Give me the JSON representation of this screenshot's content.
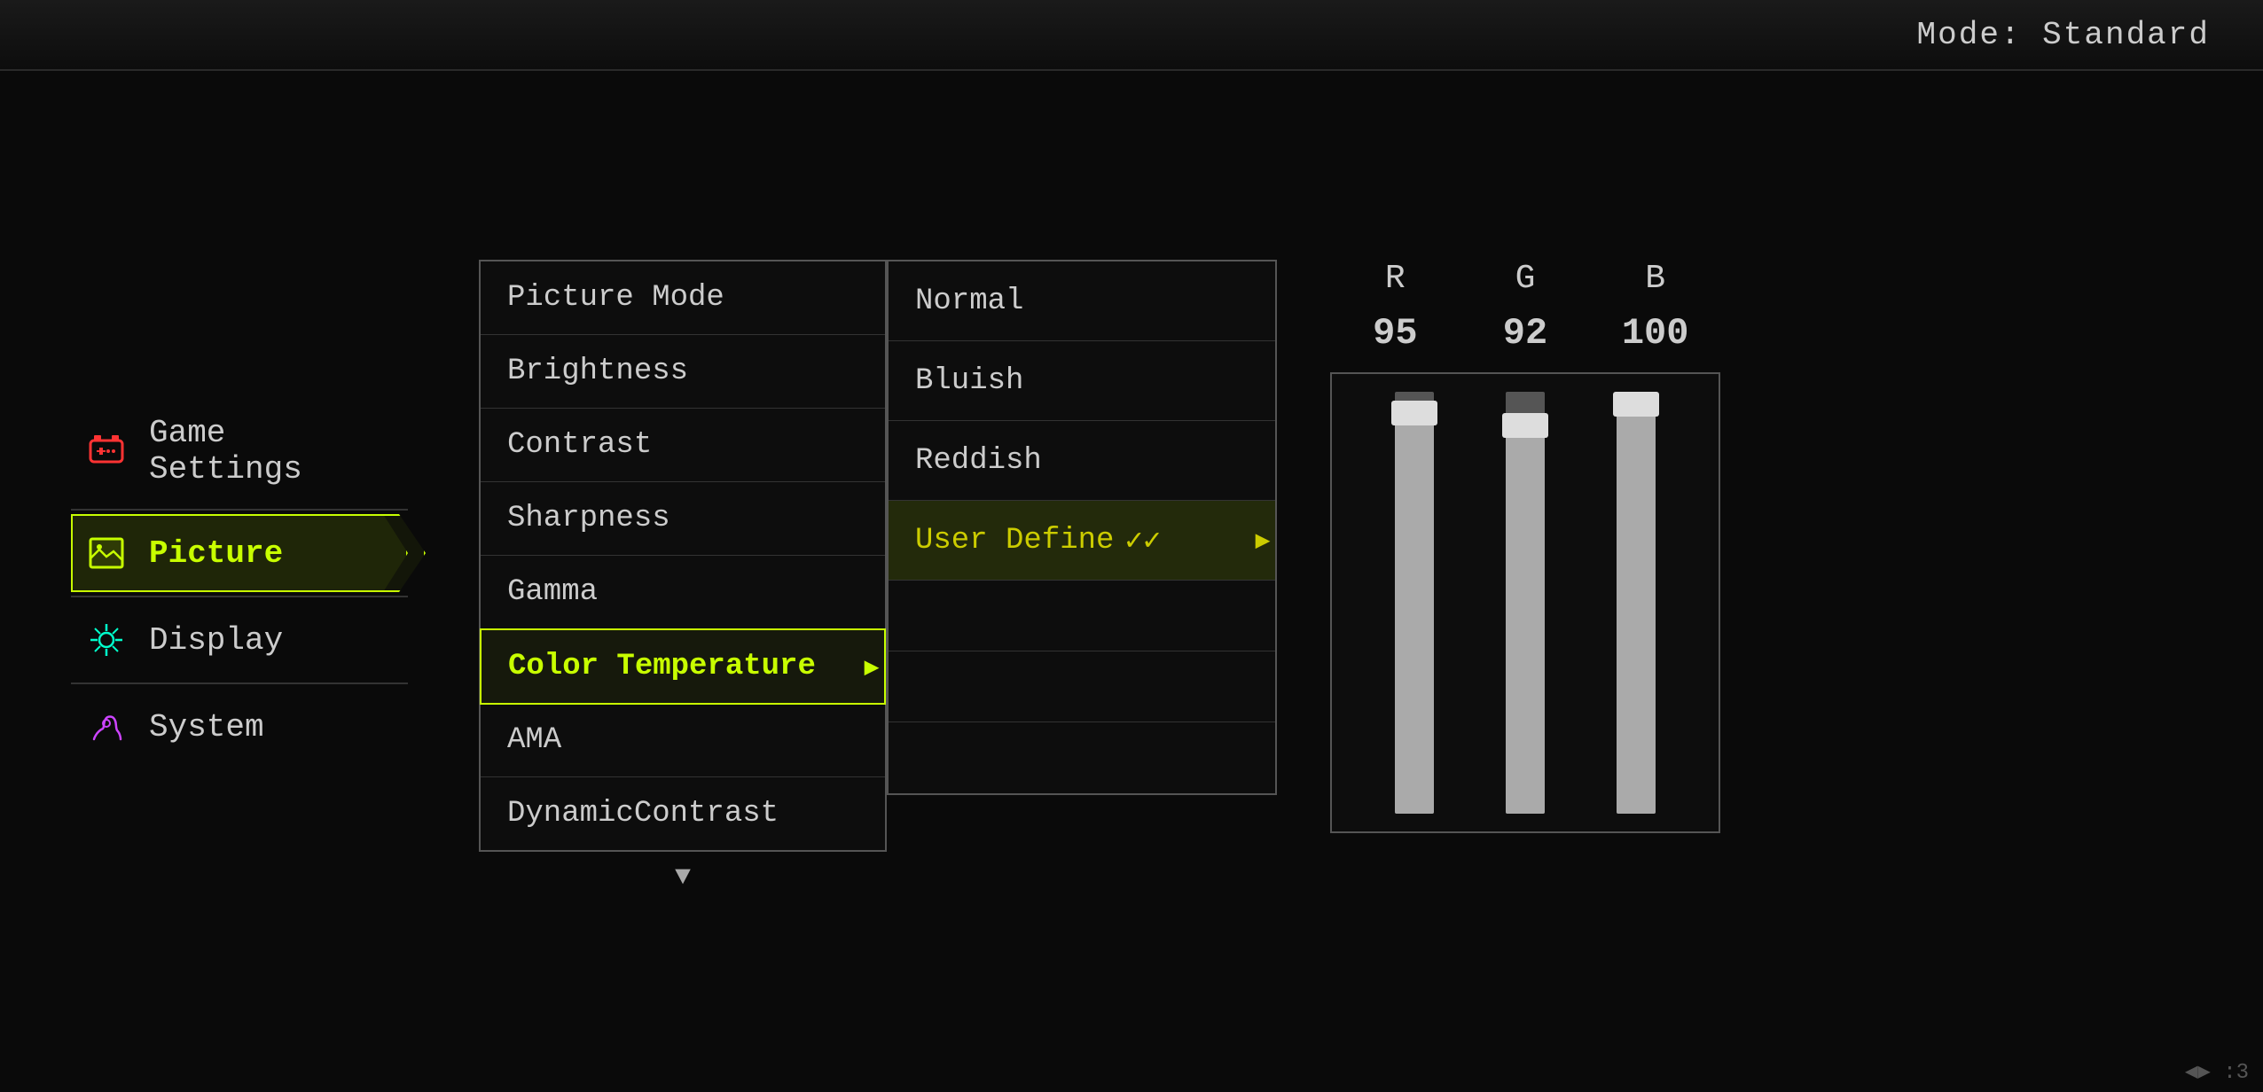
{
  "topbar": {
    "mode_label": "Mode: Standard"
  },
  "nav": {
    "items": [
      {
        "id": "game-settings",
        "label": "Game Settings",
        "icon": "game",
        "active": false
      },
      {
        "id": "picture",
        "label": "Picture",
        "icon": "picture",
        "active": true
      },
      {
        "id": "display",
        "label": "Display",
        "icon": "display",
        "active": false
      },
      {
        "id": "system",
        "label": "System",
        "icon": "system",
        "active": false
      }
    ]
  },
  "picture_menu": {
    "items": [
      {
        "id": "picture-mode",
        "label": "Picture Mode",
        "active": false
      },
      {
        "id": "brightness",
        "label": "Brightness",
        "active": false
      },
      {
        "id": "contrast",
        "label": "Contrast",
        "active": false
      },
      {
        "id": "sharpness",
        "label": "Sharpness",
        "active": false
      },
      {
        "id": "gamma",
        "label": "Gamma",
        "active": false
      },
      {
        "id": "color-temperature",
        "label": "Color Temperature",
        "active": true
      },
      {
        "id": "ama",
        "label": "AMA",
        "active": false
      },
      {
        "id": "dynamic-contrast",
        "label": "DynamicContrast",
        "active": false
      }
    ],
    "arrow_down": "▼"
  },
  "color_temp_menu": {
    "items": [
      {
        "id": "normal",
        "label": "Normal",
        "active": false
      },
      {
        "id": "bluish",
        "label": "Bluish",
        "active": false
      },
      {
        "id": "reddish",
        "label": "Reddish",
        "active": false
      },
      {
        "id": "user-define",
        "label": "User Define",
        "active": true
      },
      {
        "id": "empty1",
        "label": "",
        "active": false
      },
      {
        "id": "empty2",
        "label": "",
        "active": false
      },
      {
        "id": "empty3",
        "label": "",
        "active": false
      }
    ]
  },
  "rgb": {
    "headers": [
      "R",
      "G",
      "B"
    ],
    "values": [
      "95",
      "92",
      "100"
    ],
    "sliders": [
      {
        "id": "r-slider",
        "pct": 95
      },
      {
        "id": "g-slider",
        "pct": 92
      },
      {
        "id": "b-slider",
        "pct": 100
      }
    ]
  },
  "bottom_corner": "◀▶ :3"
}
